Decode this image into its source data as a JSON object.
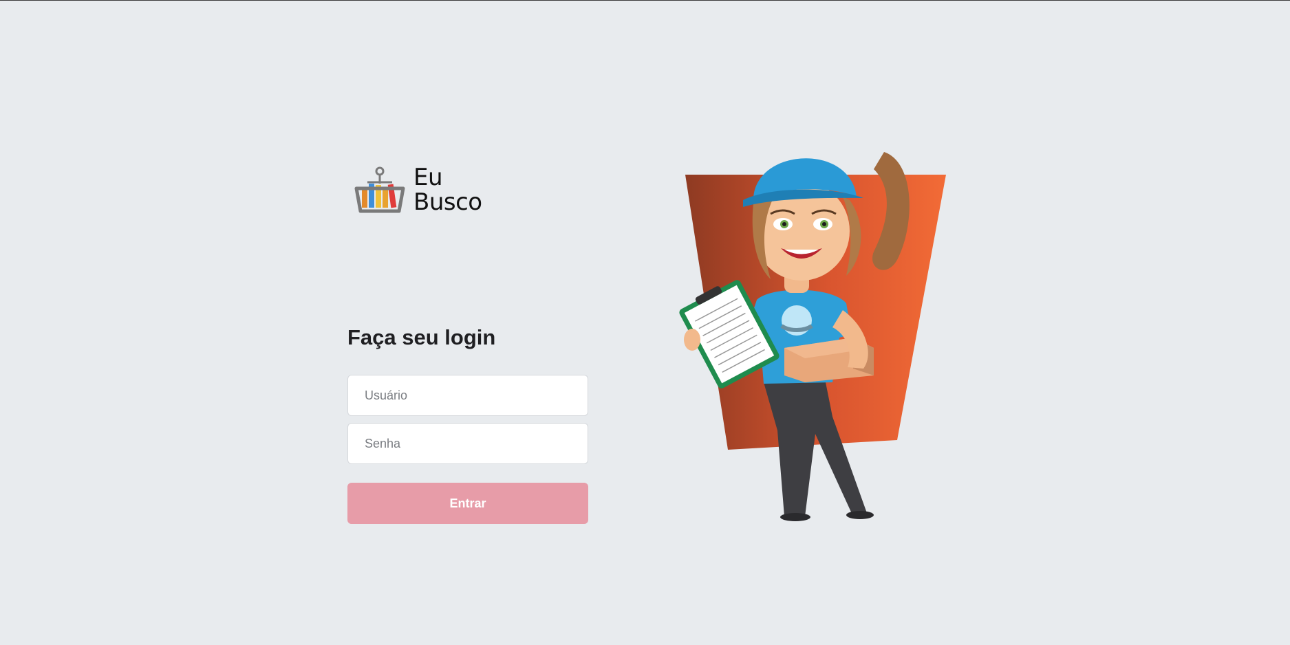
{
  "brand": {
    "line1": "Eu",
    "line2": "Busco",
    "icon": "shopping-basket-icon"
  },
  "login": {
    "title": "Faça seu login",
    "username_placeholder": "Usuário",
    "password_placeholder": "Senha",
    "submit_label": "Entrar"
  },
  "illustration": {
    "subject": "delivery-woman-with-clipboard-and-box",
    "background_color": "#ea5f34"
  },
  "colors": {
    "background": "#e8ebee",
    "button": "#e79ca8",
    "text": "#1f1f22"
  }
}
